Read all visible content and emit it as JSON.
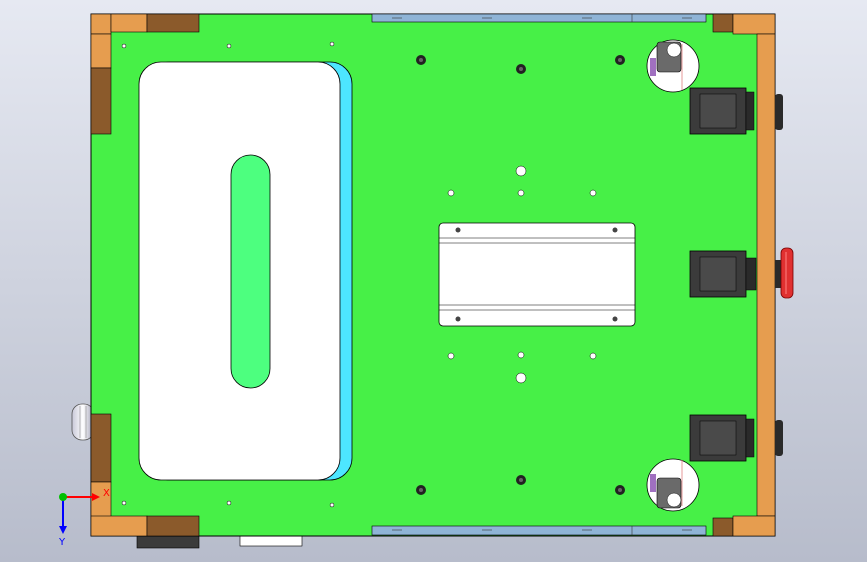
{
  "viewport": {
    "background_top": "#e6e9f2",
    "background_bottom": "#b7bccb"
  },
  "colors": {
    "plate_green": "#47f047",
    "slot_green": "#4dff7f",
    "wood_light": "#e69d4f",
    "wood_dark": "#8b5a2b",
    "cyan_edge": "#4de6ff",
    "rail_blue": "#8fb4d6",
    "bracket_white": "#ffffff",
    "dark_part": "#3b3b3b",
    "red_button": "#e03030",
    "outline": "#000000"
  },
  "axis_triad": {
    "x_label": "X",
    "y_label": "Y",
    "x_color": "#ff0000",
    "y_color": "#0000ff",
    "origin_color": "#00c000"
  },
  "parts": {
    "base_plate": "base-plate",
    "battery_pad": "battery-pad",
    "center_slot": "center-slot",
    "controller_bracket": "controller-bracket",
    "caster_wheels": [
      "caster-wheel-top",
      "caster-wheel-bottom"
    ],
    "motor_mounts": [
      "motor-mount-top",
      "motor-mount-middle",
      "motor-mount-bottom"
    ],
    "emergency_button": "emergency-stop-button"
  }
}
